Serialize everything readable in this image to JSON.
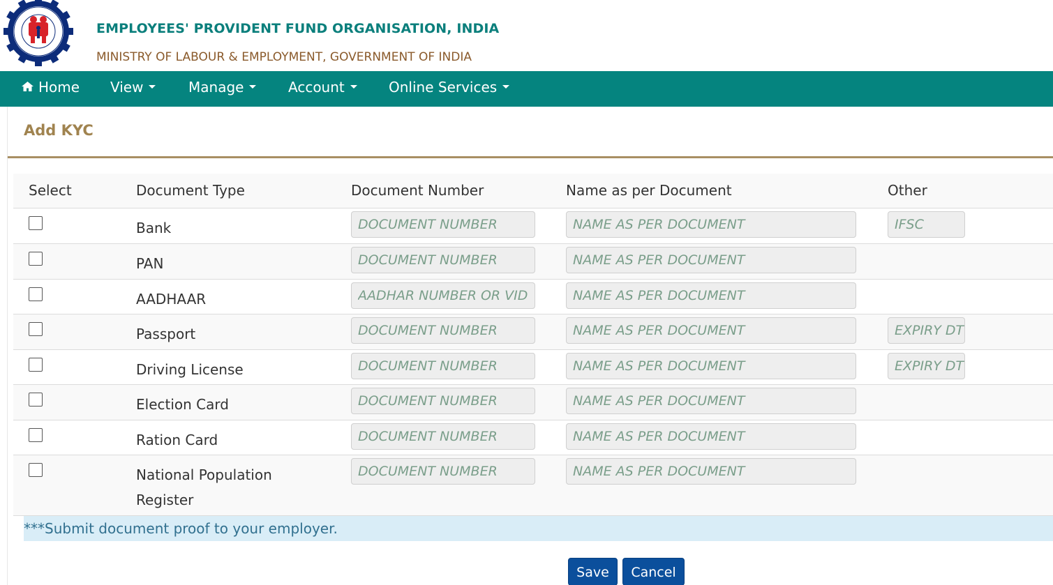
{
  "header": {
    "org_title": "EMPLOYEES' PROVIDENT FUND ORGANISATION, INDIA",
    "org_subtitle": "MINISTRY OF LABOUR & EMPLOYMENT, GOVERNMENT OF INDIA",
    "logo_icon": "epfo-emblem-icon"
  },
  "nav": {
    "home": "Home",
    "view": "View",
    "manage": "Manage",
    "account": "Account",
    "online_services": "Online Services"
  },
  "page": {
    "title": "Add KYC"
  },
  "table": {
    "headers": {
      "select": "Select",
      "document_type": "Document Type",
      "document_number": "Document Number",
      "name_as_per_document": "Name as per Document",
      "other": "Other"
    },
    "rows": [
      {
        "label": "Bank",
        "docnum_placeholder": "DOCUMENT NUMBER",
        "name_placeholder": "NAME AS PER DOCUMENT",
        "other_placeholder": "IFSC"
      },
      {
        "label": "PAN",
        "docnum_placeholder": "DOCUMENT NUMBER",
        "name_placeholder": "NAME AS PER DOCUMENT"
      },
      {
        "label": "AADHAAR",
        "docnum_placeholder": "AADHAR NUMBER OR VID",
        "name_placeholder": "NAME AS PER DOCUMENT"
      },
      {
        "label": "Passport",
        "docnum_placeholder": "DOCUMENT NUMBER",
        "name_placeholder": "NAME AS PER DOCUMENT",
        "other_placeholder": "EXPIRY DT"
      },
      {
        "label": "Driving License",
        "docnum_placeholder": "DOCUMENT NUMBER",
        "name_placeholder": "NAME AS PER DOCUMENT",
        "other_placeholder": "EXPIRY DT"
      },
      {
        "label": "Election Card",
        "docnum_placeholder": "DOCUMENT NUMBER",
        "name_placeholder": "NAME AS PER DOCUMENT"
      },
      {
        "label": "Ration Card",
        "docnum_placeholder": "DOCUMENT NUMBER",
        "name_placeholder": "NAME AS PER DOCUMENT"
      },
      {
        "label": "National Population Register",
        "docnum_placeholder": "DOCUMENT NUMBER",
        "name_placeholder": "NAME AS PER DOCUMENT"
      }
    ]
  },
  "note": "***Submit document proof to your employer.",
  "buttons": {
    "save": "Save",
    "cancel": "Cancel"
  },
  "colors": {
    "nav_bg": "#05847f",
    "title_teal": "#0b7f7c",
    "subtitle_brown": "#8a5a2b",
    "panel_title": "#a0834f",
    "button_blue": "#0b4f9c",
    "note_bg": "#d9edf7"
  }
}
